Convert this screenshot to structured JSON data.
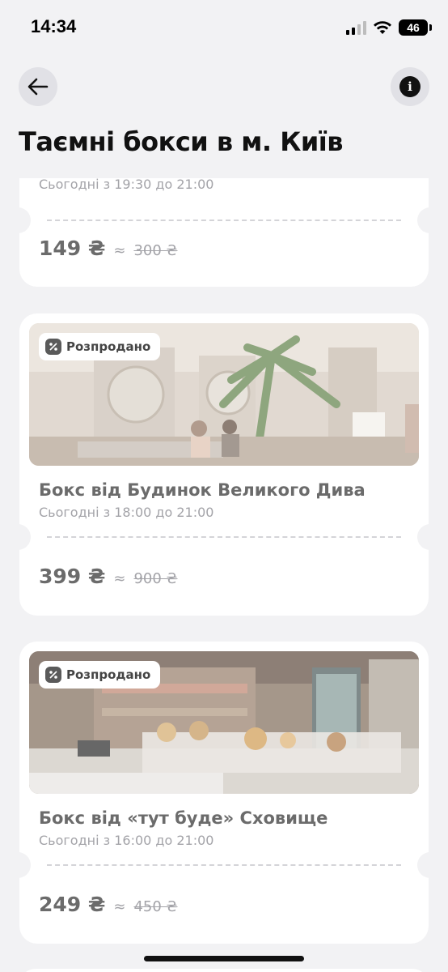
{
  "status": {
    "time": "14:34",
    "battery": "46"
  },
  "nav": {
    "back_icon": "arrow-left-icon",
    "info_icon": "info-icon",
    "info_glyph": "i"
  },
  "page": {
    "title": "Таємні бокси в м. Київ"
  },
  "cards": [
    {
      "title": "",
      "time": "Сьогодні з 19:30 до 21:00",
      "price": "149 ₴",
      "approx": "≈",
      "old_price": "300 ₴"
    },
    {
      "badge": "Розпродано",
      "title": "Бокс від Будинок Великого Дива",
      "time": "Сьогодні з 18:00 до 21:00",
      "price": "399 ₴",
      "approx": "≈",
      "old_price": "900 ₴"
    },
    {
      "badge": "Розпродано",
      "title": "Бокс від «тут буде» Сховище",
      "time": "Сьогодні з 16:00 до 21:00",
      "price": "249 ₴",
      "approx": "≈",
      "old_price": "450 ₴"
    }
  ]
}
